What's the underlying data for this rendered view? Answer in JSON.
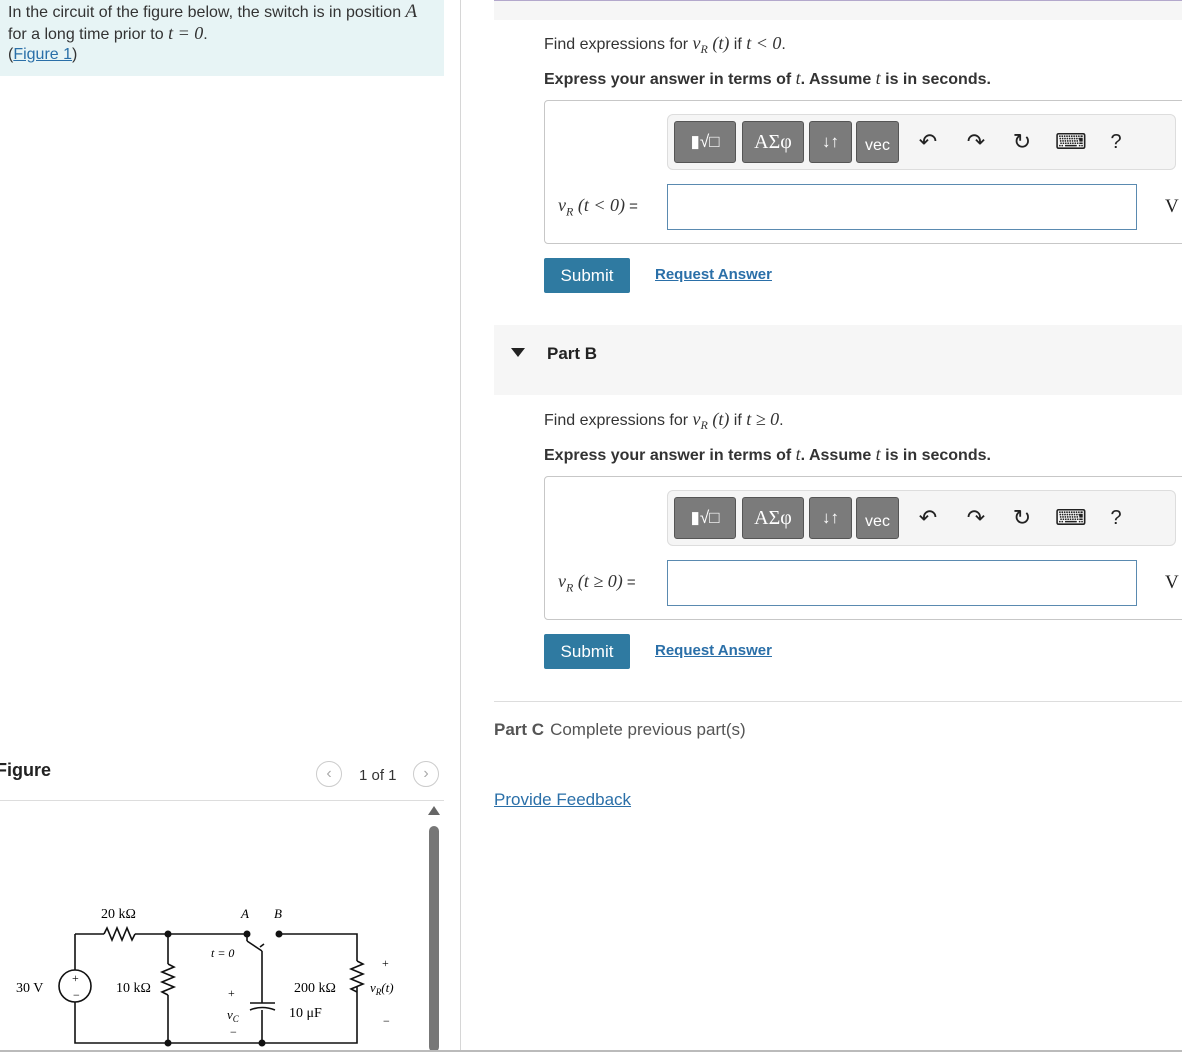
{
  "problem": {
    "line1": "In the circuit of the figure below, the switch is in position ",
    "line1_var": "A",
    "line2": "for a long time prior to ",
    "line2_math": "t = 0",
    "line2_end": ".",
    "link_open": "(",
    "figure_link": "Figure 1",
    "link_close": ")"
  },
  "figure": {
    "title": "Figure",
    "pager": "1 of 1",
    "prev_icon": "‹",
    "next_icon": "›",
    "circuit": {
      "source": "30 V",
      "r1": "20 kΩ",
      "r2": "10 kΩ",
      "pos_a": "A",
      "pos_b": "B",
      "switch_time": "t = 0",
      "r3": "200 kΩ",
      "cap": "10 μF",
      "vc": "v",
      "vc_sub": "C",
      "vr": "v",
      "vr_sub": "R",
      "vr_arg": "(t)",
      "plus": "+",
      "minus": "−"
    }
  },
  "partA": {
    "prompt_pre": "Find expressions for ",
    "prompt_var": "v",
    "prompt_sub": "R",
    "prompt_arg": " (t)",
    "prompt_if": " if ",
    "prompt_cond": "t < 0",
    "prompt_end": ".",
    "instr_pre": "Express your answer in terms of ",
    "instr_var": "t",
    "instr_mid": ". Assume ",
    "instr_var2": "t",
    "instr_end": " is in seconds.",
    "label_var": "v",
    "label_sub": "R",
    "label_arg": " (t < 0)",
    "label_eq": " =",
    "input_value": "",
    "unit": "V",
    "submit": "Submit",
    "request": "Request Answer"
  },
  "partB": {
    "title": "Part B",
    "prompt_pre": "Find expressions for ",
    "prompt_var": "v",
    "prompt_sub": "R",
    "prompt_arg": " (t)",
    "prompt_if": " if ",
    "prompt_cond": "t ≥ 0",
    "prompt_end": ".",
    "instr_pre": "Express your answer in terms of ",
    "instr_var": "t",
    "instr_mid": ". Assume ",
    "instr_var2": "t",
    "instr_end": " is in seconds.",
    "label_var": "v",
    "label_sub": "R",
    "label_arg": " (t ≥ 0)",
    "label_eq": " =",
    "input_value": "",
    "unit": "V",
    "submit": "Submit",
    "request": "Request Answer"
  },
  "toolbar": {
    "templates_icon": "▮√□",
    "greek": "ΑΣφ",
    "arrows": "↓↑",
    "vec": "vec",
    "undo_icon": "↶",
    "redo_icon": "↷",
    "reset_icon": "↻",
    "keyboard_icon": "⌨",
    "help": "?"
  },
  "partC": {
    "label": "Part C",
    "status": "Complete previous part(s)"
  },
  "feedback": "Provide Feedback"
}
